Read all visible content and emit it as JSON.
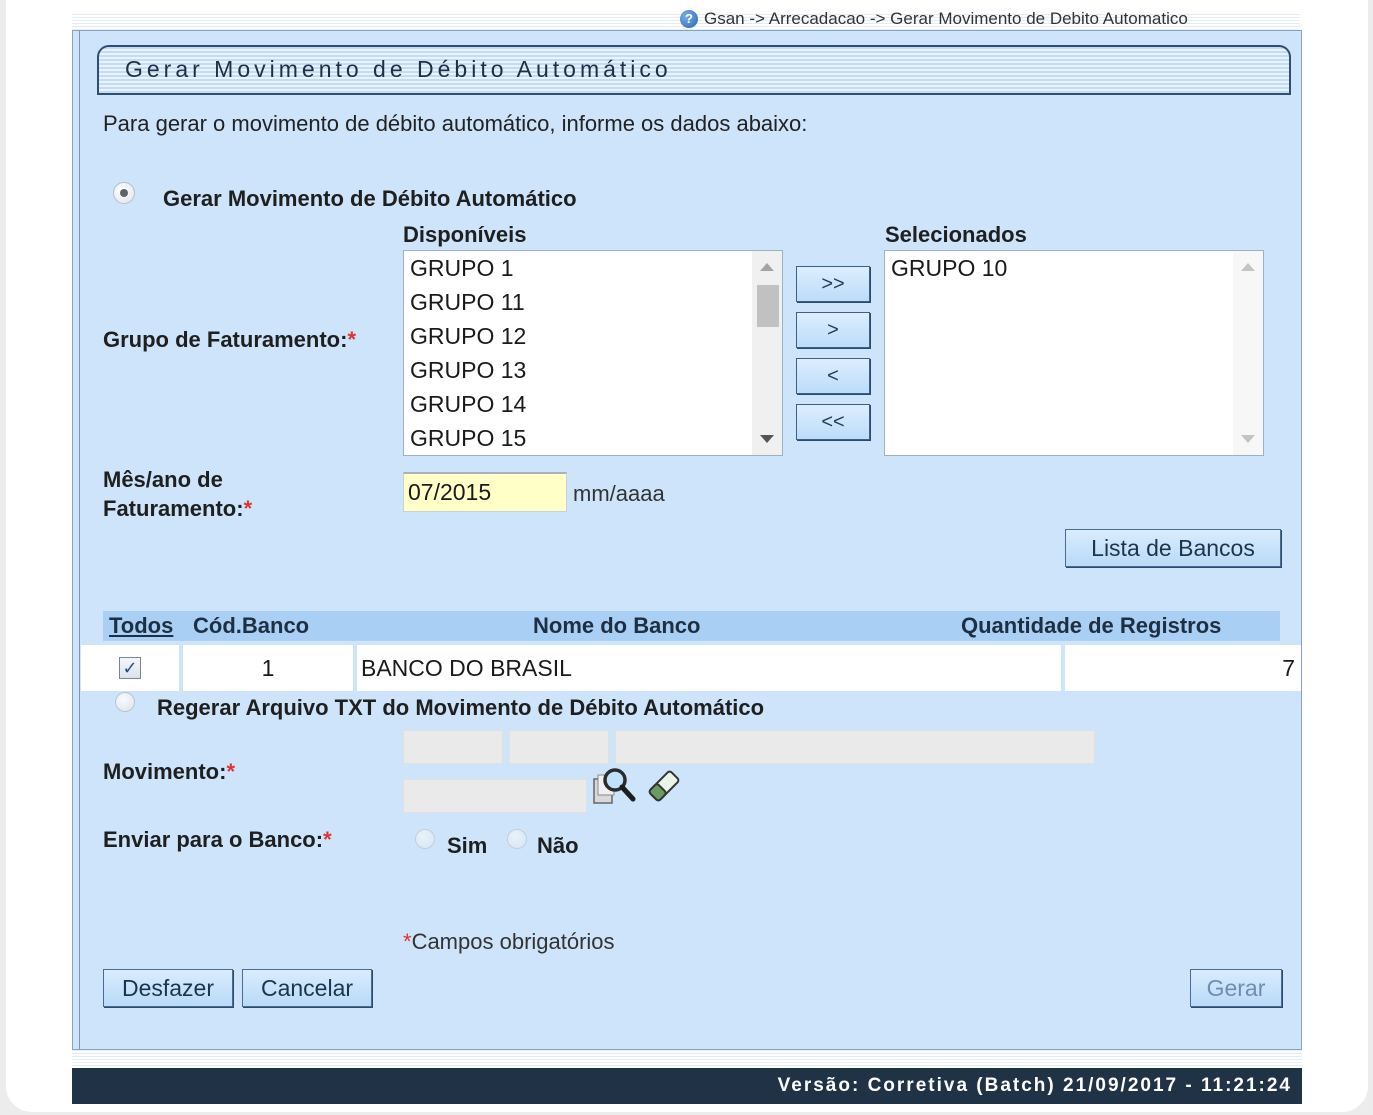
{
  "breadcrumb": "Gsan -> Arrecadacao -> Gerar Movimento de Debito Automatico",
  "title": "Gerar Movimento de Débito Automático",
  "intro": "Para gerar o movimento de débito automático, informe os dados abaixo:",
  "option_gerar": "Gerar Movimento de Débito Automático",
  "option_regerar": "Regerar Arquivo TXT do Movimento de Débito Automático",
  "grupo": {
    "label": "Grupo de Faturamento:",
    "required": "*",
    "available_title": "Disponíveis",
    "selected_title": "Selecionados",
    "available": [
      "GRUPO 1",
      "GRUPO 11",
      "GRUPO 12",
      "GRUPO 13",
      "GRUPO 14",
      "GRUPO 15"
    ],
    "selected": [
      "GRUPO 10"
    ],
    "buttons": {
      "add_all": ">>",
      "add": ">",
      "remove": "<",
      "remove_all": "<<"
    }
  },
  "mes_ano": {
    "label_line1": "Mês/ano de",
    "label_line2": "Faturamento:",
    "required": "*",
    "value": "07/2015",
    "hint": "mm/aaaa"
  },
  "lista_bancos_button": "Lista de Bancos",
  "table": {
    "headers": {
      "todos": "Todos",
      "cod": "Cód.Banco",
      "nome": "Nome do Banco",
      "qtd": "Quantidade de Registros"
    },
    "rows": [
      {
        "checked": "✓",
        "cod": "1",
        "nome": "BANCO DO BRASIL",
        "qtd": "7"
      }
    ]
  },
  "movimento": {
    "label": "Movimento:",
    "required": "*"
  },
  "enviar": {
    "label": "Enviar para o Banco:",
    "required": "*",
    "sim": "Sim",
    "nao": "Não"
  },
  "obrigatorios": {
    "mark": "*",
    "text": "Campos obrigatórios"
  },
  "buttons": {
    "desfazer": "Desfazer",
    "cancelar": "Cancelar",
    "gerar": "Gerar"
  },
  "footer": "Versão: Corretiva (Batch) 21/09/2017 - 11:21:24",
  "icons": {
    "help": "help-icon",
    "search": "magnifier-search-icon",
    "clear": "eraser-icon"
  }
}
